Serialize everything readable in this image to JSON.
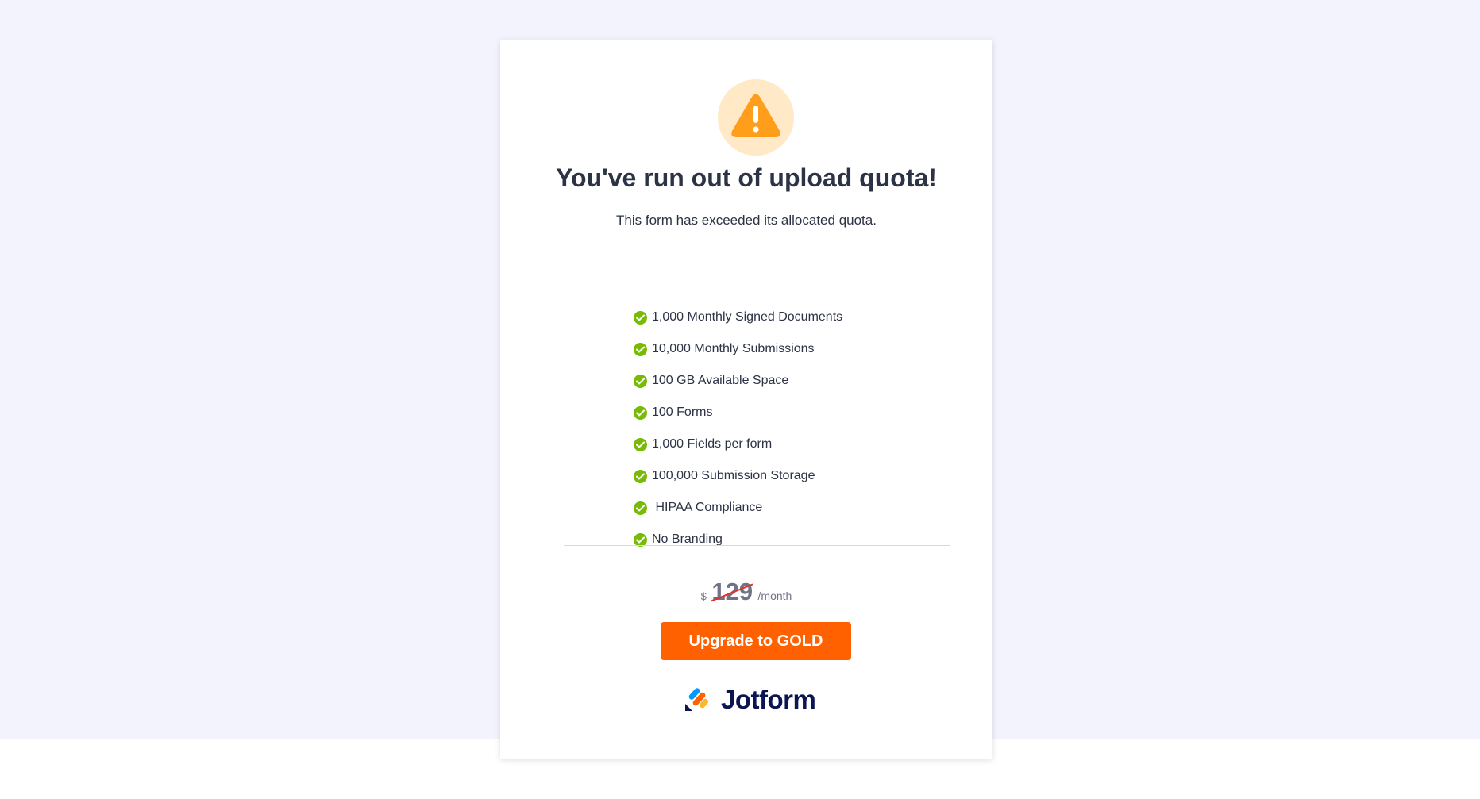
{
  "dialog": {
    "icon": "warning-icon",
    "title": "You've run out of upload quota!",
    "subtitle": "This form has exceeded its allocated quota."
  },
  "features": [
    "1,000 Monthly Signed Documents",
    "10,000 Monthly Submissions",
    "100 GB Available Space",
    "100 Forms",
    "1,000 Fields per form",
    "100,000 Submission Storage",
    " HIPAA Compliance",
    "No Branding"
  ],
  "pricing": {
    "currency": "$",
    "amount": "129",
    "period": "/month"
  },
  "upgrade": {
    "label": "Upgrade to GOLD"
  },
  "brand": {
    "name": "Jotform"
  },
  "colors": {
    "accent": "#ff6100",
    "warning": "#ff9e1b",
    "check": "#78bb07",
    "text": "#2c3345",
    "background": "#f3f3fe"
  }
}
